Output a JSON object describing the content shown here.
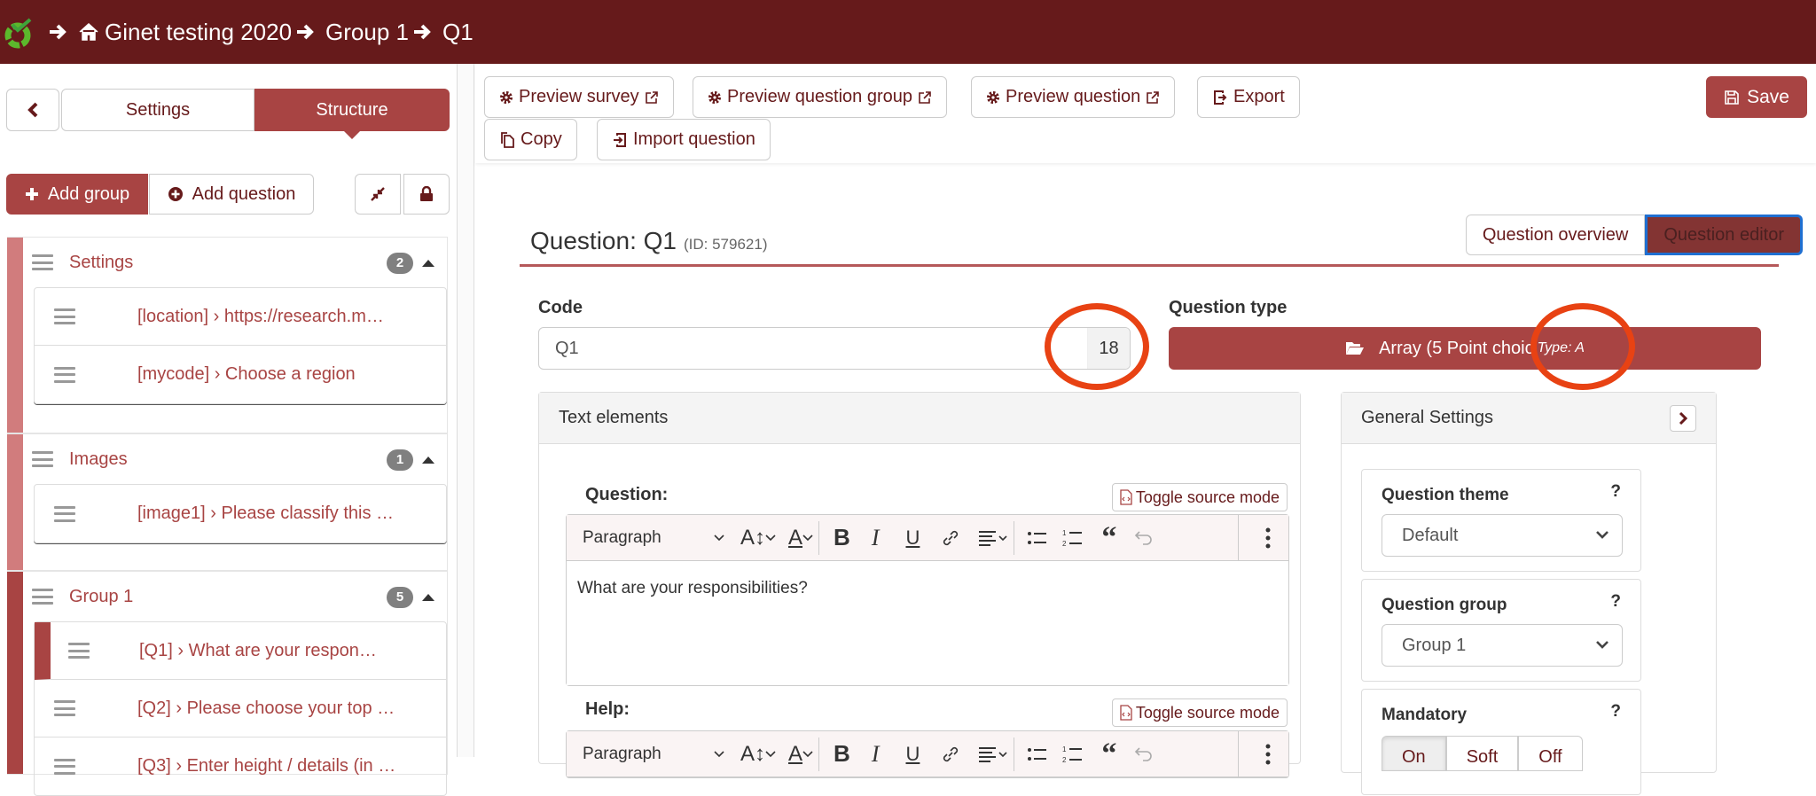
{
  "breadcrumb": {
    "items": [
      "Ginet testing 2020",
      "Group 1",
      "Q1"
    ]
  },
  "sidebar": {
    "tabs": {
      "settings": "Settings",
      "structure": "Structure"
    },
    "add_group_label": "Add group",
    "add_question_label": "Add question",
    "groups": [
      {
        "title": "Settings",
        "count": "2",
        "color": "#d17c7d",
        "questions": [
          {
            "label": "[location] › https://research.m…",
            "active": false
          },
          {
            "label": "[mycode] › Choose a region",
            "active": false
          }
        ]
      },
      {
        "title": "Images",
        "count": "1",
        "color": "#d17c7d",
        "questions": [
          {
            "label": "[image1] › Please classify this …",
            "active": false
          }
        ]
      },
      {
        "title": "Group 1",
        "count": "5",
        "color": "#a84443",
        "questions": [
          {
            "label": "[Q1] › What are your respon…",
            "active": true
          },
          {
            "label": "[Q2] › Please choose your top …",
            "active": false
          },
          {
            "label": "[Q3] › Enter height / details (in …",
            "active": false
          }
        ]
      }
    ]
  },
  "toolbar": {
    "preview_survey": "Preview survey",
    "preview_group": "Preview question group",
    "preview_question": "Preview question",
    "export": "Export",
    "copy": "Copy",
    "import_question": "Import question",
    "save": "Save"
  },
  "question": {
    "title": "Question: Q1",
    "id_text": "(ID: 579621)",
    "view_overview": "Question overview",
    "view_editor": "Question editor",
    "code_label": "Code",
    "code_value": "Q1",
    "code_count": "18",
    "type_label": "Question type",
    "type_value": "Array (5 Point choic",
    "type_code": "Type: A"
  },
  "text_elements": {
    "header": "Text elements",
    "question_label": "Question:",
    "help_label": "Help:",
    "toggle_source": "Toggle source mode",
    "paragraph": "Paragraph",
    "question_text": "What are your responsibilities?"
  },
  "general_settings": {
    "header": "General Settings",
    "theme_label": "Question theme",
    "theme_value": "Default",
    "group_label": "Question group",
    "group_value": "Group 1",
    "mandatory_label": "Mandatory",
    "mandatory_options": [
      "On",
      "Soft",
      "Off"
    ],
    "mandatory_selected": "On",
    "help_mark": "?"
  },
  "colors": {
    "brand_dark": "#661a1b",
    "brand": "#a84443",
    "annotation": "#e84213"
  }
}
